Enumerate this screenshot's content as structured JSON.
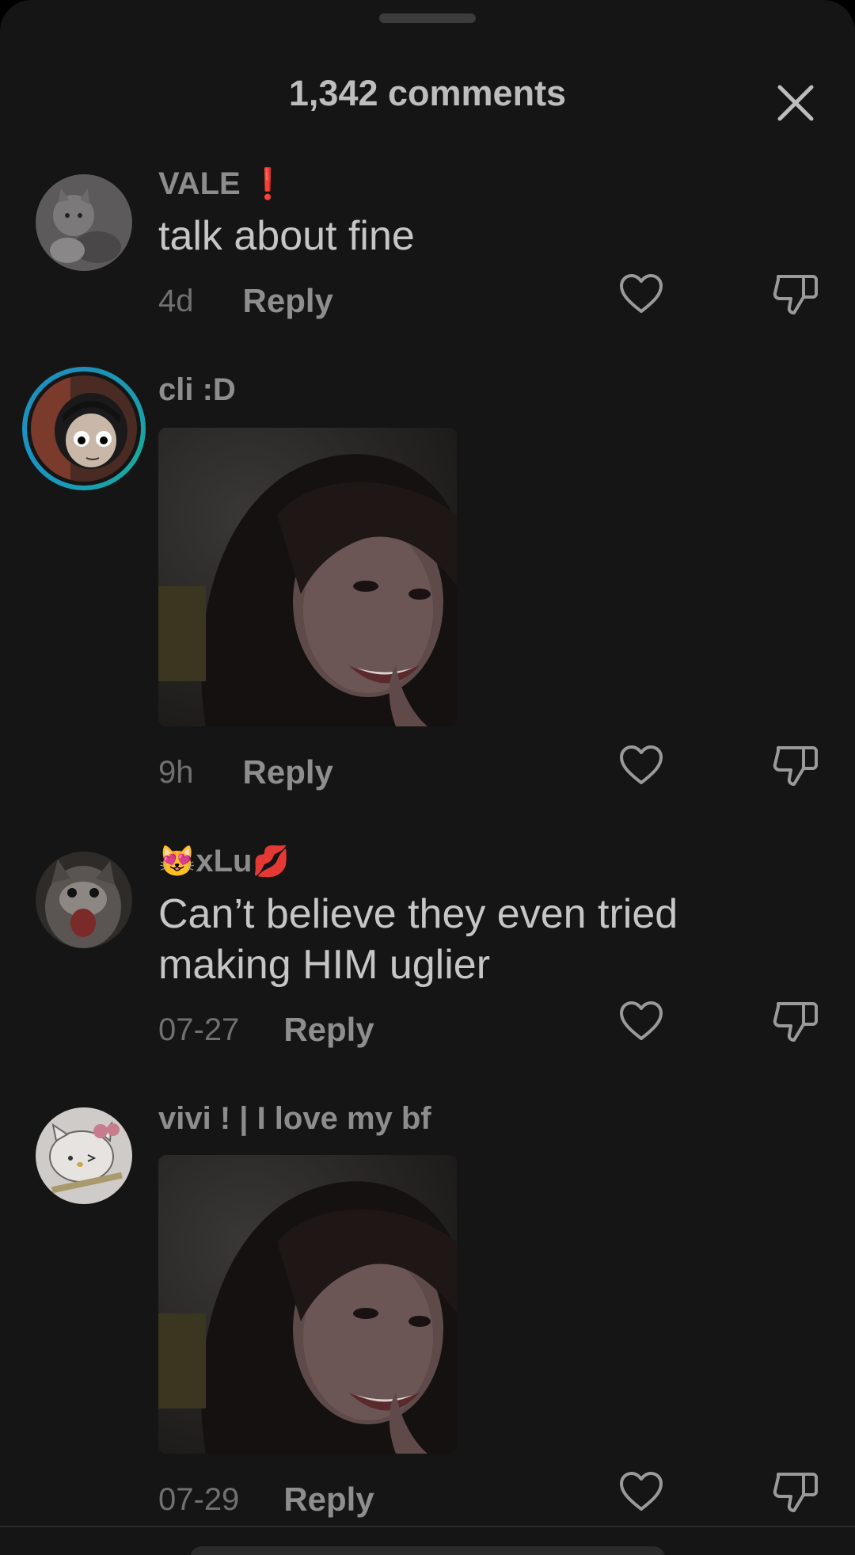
{
  "header": {
    "title": "1,342 comments",
    "close_icon": "close-icon"
  },
  "colors": {
    "background": "#151515",
    "text_primary": "#c6c6c6",
    "text_muted": "#707070",
    "ring": "#18a99f",
    "alert_red": "#d11f2c"
  },
  "comments": [
    {
      "username": "VALE",
      "username_emoji": "❗",
      "text": "talk about fine",
      "time": "4d",
      "reply_label": "Reply",
      "avatar": "cat-avatar"
    },
    {
      "username": "cli :D",
      "attachment": "photo-of-girl",
      "time": "9h",
      "reply_label": "Reply",
      "avatar": "anime-character-avatar"
    },
    {
      "username_prefix_emoji": "😻",
      "username": "xLu",
      "username_suffix_emoji": "💋",
      "text": "Can’t believe they even tried making HIM uglier",
      "time": "07-27",
      "reply_label": "Reply",
      "avatar": "screaming-cat-avatar"
    },
    {
      "username": "vivi ! | I love my bf",
      "attachment": "photo-of-girl",
      "time": "07-29",
      "reply_label": "Reply",
      "avatar": "hello-kitty-avatar"
    }
  ]
}
